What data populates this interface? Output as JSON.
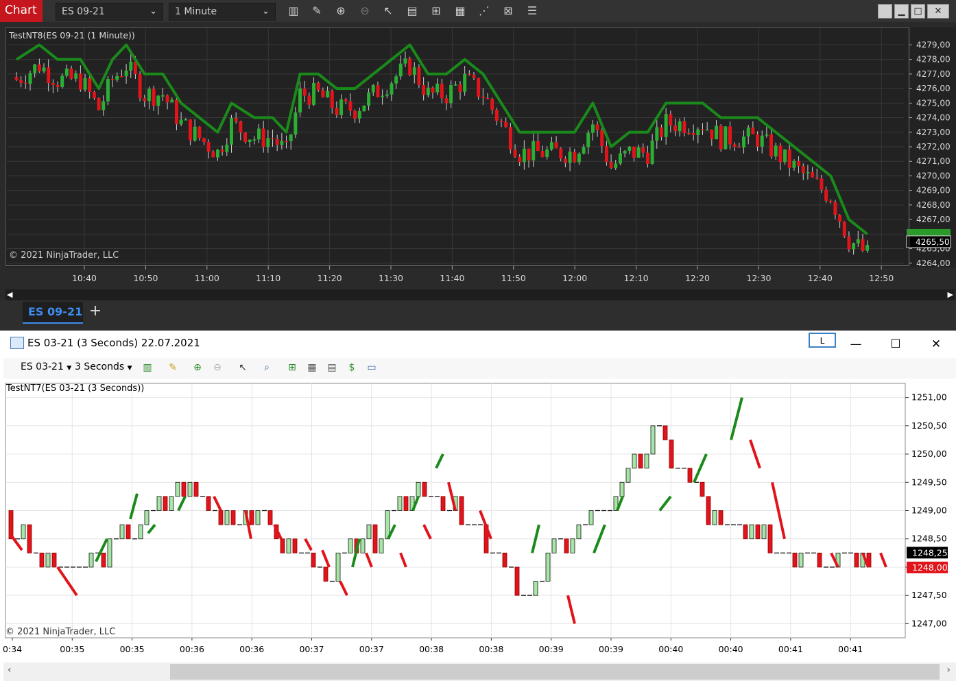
{
  "nt8": {
    "title": "Chart",
    "instrument": "ES 09-21",
    "interval": "1 Minute",
    "chart_label": "TestNT8(ES 09-21 (1 Minute))",
    "copyright": "© 2021 NinjaTrader, LLC",
    "active_tab": "ES 09-21",
    "add_tab": "+",
    "tools": [
      "bars-icon",
      "pencil-icon",
      "zoom-in-icon",
      "zoom-out-icon",
      "pointer-icon",
      "data-box-icon",
      "properties-icon",
      "indicators-icon",
      "strategies-icon",
      "chart-trader-icon",
      "list-icon"
    ],
    "win_buttons": [
      "▬",
      "▁",
      "□",
      "✕"
    ],
    "colors": {
      "up": "#2bae34",
      "down": "#e0141a",
      "line": "#1a8a1a",
      "price_box": "#2a9a2a"
    }
  },
  "nt8_chart": {
    "type": "line",
    "price_labels": [
      "4279,00",
      "4278,00",
      "4277,00",
      "4276,00",
      "4275,00",
      "4274,00",
      "4273,00",
      "4272,00",
      "4271,00",
      "4270,00",
      "4269,00",
      "4268,00",
      "4267,00",
      "4266,00",
      "4265,00",
      "4264,00"
    ],
    "current_price": "4265,50",
    "time_labels": [
      "10:40",
      "10:50",
      "11:00",
      "11:10",
      "11:20",
      "11:30",
      "11:40",
      "11:50",
      "12:00",
      "12:10",
      "12:20",
      "12:30",
      "12:40",
      "12:50"
    ],
    "ylim": [
      4263.8,
      4280.2
    ],
    "trend_line": [
      [
        0,
        4278
      ],
      [
        5,
        4279
      ],
      [
        9,
        4278
      ],
      [
        14,
        4278
      ],
      [
        18,
        4276
      ],
      [
        21,
        4278
      ],
      [
        24,
        4279
      ],
      [
        28,
        4277
      ],
      [
        32,
        4277
      ],
      [
        36,
        4275
      ],
      [
        40,
        4274
      ],
      [
        44,
        4273
      ],
      [
        47,
        4275
      ],
      [
        52,
        4274
      ],
      [
        56,
        4274
      ],
      [
        59,
        4273
      ],
      [
        62,
        4277
      ],
      [
        66,
        4277
      ],
      [
        70,
        4276
      ],
      [
        74,
        4276
      ],
      [
        78,
        4277
      ],
      [
        82,
        4278
      ],
      [
        86,
        4279
      ],
      [
        90,
        4277
      ],
      [
        94,
        4277
      ],
      [
        98,
        4278
      ],
      [
        102,
        4277
      ],
      [
        106,
        4275
      ],
      [
        110,
        4273
      ],
      [
        114,
        4273
      ],
      [
        118,
        4273
      ],
      [
        122,
        4273
      ],
      [
        126,
        4275
      ],
      [
        130,
        4272
      ],
      [
        134,
        4273
      ],
      [
        138,
        4273
      ],
      [
        142,
        4275
      ],
      [
        146,
        4275
      ],
      [
        150,
        4275
      ],
      [
        154,
        4274
      ],
      [
        158,
        4274
      ],
      [
        162,
        4274
      ],
      [
        166,
        4273
      ],
      [
        170,
        4272
      ],
      [
        174,
        4271
      ],
      [
        178,
        4270
      ],
      [
        182,
        4267
      ],
      [
        186,
        4266
      ]
    ]
  },
  "nt7": {
    "title": "ES 03-21 (3 Seconds)  22.07.2021",
    "layout_button": "L",
    "instrument": "ES 03-21",
    "interval": "3 Seconds",
    "chart_label": "TestNT7(ES 03-21 (3 Seconds))",
    "copyright": "© 2021 NinjaTrader, LLC",
    "win_buttons": [
      "—",
      "☐",
      "✕"
    ],
    "colors": {
      "up": "#2aa02a",
      "down": "#e0141a",
      "bid": "#e0141a",
      "ask": "#1a1a1a"
    }
  },
  "nt7_chart": {
    "type": "line",
    "price_labels": [
      "1251,00",
      "1250,50",
      "1250,00",
      "1249,50",
      "1249,00",
      "1248,50",
      "1248,00",
      "1247,50",
      "1247,00"
    ],
    "last_price": "1248,25",
    "bid_price": "1248,00",
    "time_labels": [
      "0:34",
      "00:35",
      "00:35",
      "00:36",
      "00:36",
      "00:37",
      "00:37",
      "00:38",
      "00:38",
      "00:39",
      "00:39",
      "00:40",
      "00:40",
      "00:41",
      "00:41"
    ],
    "ylim": [
      1246.75,
      1251.25
    ]
  }
}
